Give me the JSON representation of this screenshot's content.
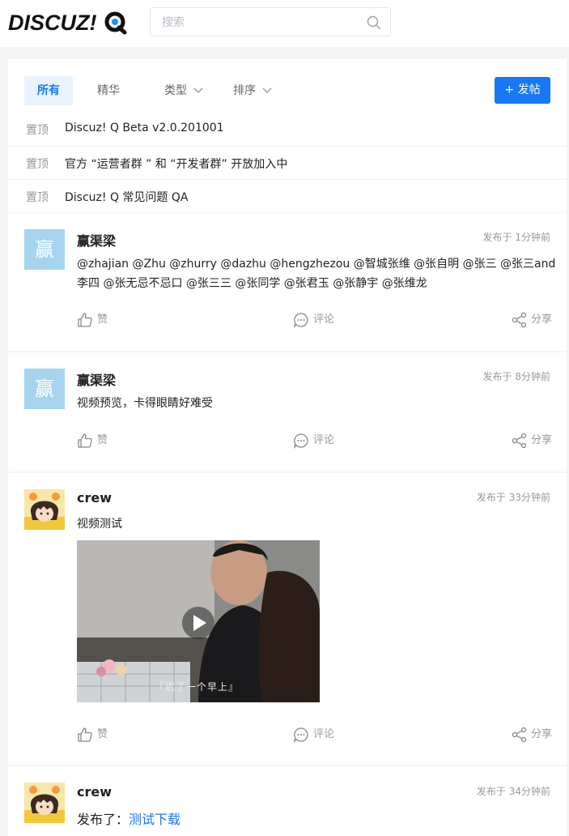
{
  "header": {
    "logo_text": "DISCUZ!Q",
    "search_placeholder": "搜索",
    "search_icon": "search-icon"
  },
  "tabs": [
    {
      "label": "所有",
      "active": true
    },
    {
      "label": "精华",
      "active": false
    },
    {
      "label": "类型",
      "active": false,
      "has_dropdown": true
    },
    {
      "label": "排序",
      "active": false,
      "has_dropdown": true
    }
  ],
  "post_button": "+ 发帖",
  "sticky": [
    {
      "tag": "置顶",
      "title": "Discuz! Q Beta v2.0.201001"
    },
    {
      "tag": "置顶",
      "title": "官方 “运营者群 ” 和 “开发者群” 开放加入中"
    },
    {
      "tag": "置顶",
      "title": "Discuz! Q 常见问题 QA"
    }
  ],
  "threads": [
    {
      "avatar_text": "赢",
      "author": "赢渠梁",
      "time": "发布于 1分钟前",
      "mentions_line1": "@zhajian @Zhu @zhurry @dazhu @hengzhezou @智城张维 @张自明 @张三 @张三and",
      "mentions_line2": "李四 @张无忌不忌口 @张三三 @张同学 @张君玉 @张静宇 @张维龙"
    },
    {
      "avatar_text": "赢",
      "author": "赢渠梁",
      "time": "发布于 8分钟前",
      "text": "视频预览，卡得眼睛好难受"
    },
    {
      "author": "crew",
      "time": "发布于 33分钟前",
      "text": "视频测试",
      "video_subtitle": "『迟了一个早上』"
    },
    {
      "author": "crew",
      "time": "发布于 34分钟前",
      "text_prefix": "发布了：",
      "link_text": "测试下载"
    }
  ],
  "actions": {
    "like": "赞",
    "comment": "评论",
    "share": "分享"
  },
  "colors": {
    "accent": "#1878f3",
    "avatar_bg": "#a6d4ef",
    "page_bg": "#f4f5f6"
  }
}
